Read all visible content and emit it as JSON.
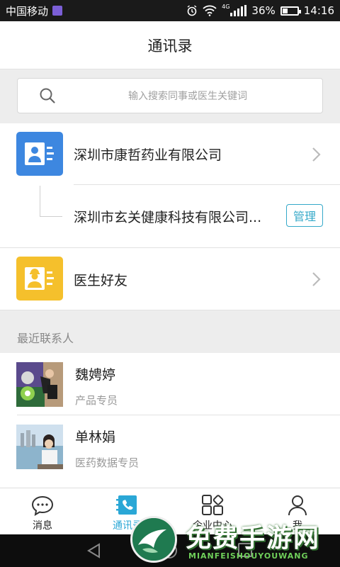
{
  "status_bar": {
    "carrier": "中国移动",
    "network_tag": "4G",
    "battery": "36%",
    "battery_level": 0.36,
    "time": "14:16"
  },
  "header": {
    "title": "通讯录"
  },
  "search": {
    "placeholder": "输入搜索同事或医生关键词"
  },
  "organization": {
    "company": "深圳市康哲药业有限公司",
    "sub_company": "深圳市玄关健康科技有限公司...",
    "manage_label": "管理"
  },
  "doctors": {
    "label": "医生好友"
  },
  "recent": {
    "title": "最近联系人",
    "contacts": [
      {
        "name": "魏娉婷",
        "role": "产品专员"
      },
      {
        "name": "单林娟",
        "role": "医药数据专员"
      }
    ]
  },
  "tabs": [
    {
      "label": "消息",
      "icon": "chat-bubble-icon"
    },
    {
      "label": "通讯录",
      "icon": "phone-book-icon"
    },
    {
      "label": "企业中心",
      "icon": "apps-grid-icon"
    },
    {
      "label": "我",
      "icon": "user-icon"
    }
  ],
  "watermark": {
    "title": "免费手游网",
    "subtitle": "MIANFEISHOUYOUWANG"
  },
  "colors": {
    "accent": "#2aa7d6",
    "blue_tile": "#3d87e0",
    "yellow_tile": "#f5c02c",
    "manage": "#35a9c9"
  }
}
